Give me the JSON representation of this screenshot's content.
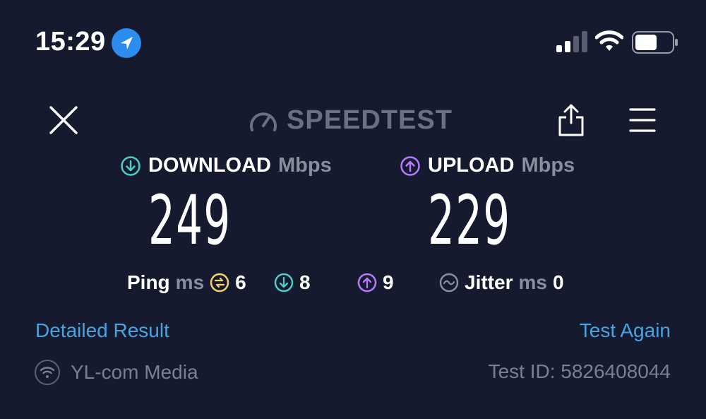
{
  "status_bar": {
    "time": "15:29",
    "icons": [
      "location-arrow-icon",
      "cellular-signal-icon",
      "wifi-icon",
      "battery-icon"
    ]
  },
  "header": {
    "logo_text": "SPEEDTEST",
    "icons": [
      "close-icon",
      "speedtest-gauge-icon",
      "share-icon",
      "menu-icon"
    ]
  },
  "download": {
    "label": "DOWNLOAD",
    "unit": "Mbps",
    "value": "249",
    "color": "#4ecdc4"
  },
  "upload": {
    "label": "UPLOAD",
    "unit": "Mbps",
    "value": "229",
    "color": "#b57bff"
  },
  "ping": {
    "label": "Ping",
    "unit": "ms",
    "idle": "6",
    "download": "8",
    "upload": "9",
    "idle_color": "#f2d46b"
  },
  "jitter": {
    "label": "Jitter",
    "unit": "ms",
    "value": "0"
  },
  "links": {
    "detailed": "Detailed Result",
    "again": "Test Again"
  },
  "footer": {
    "provider": "YL-com Media",
    "test_id": "Test ID: 5826408044"
  },
  "colors": {
    "background": "#161a2e",
    "link": "#4aa3e0",
    "muted": "#8a8e9c"
  }
}
